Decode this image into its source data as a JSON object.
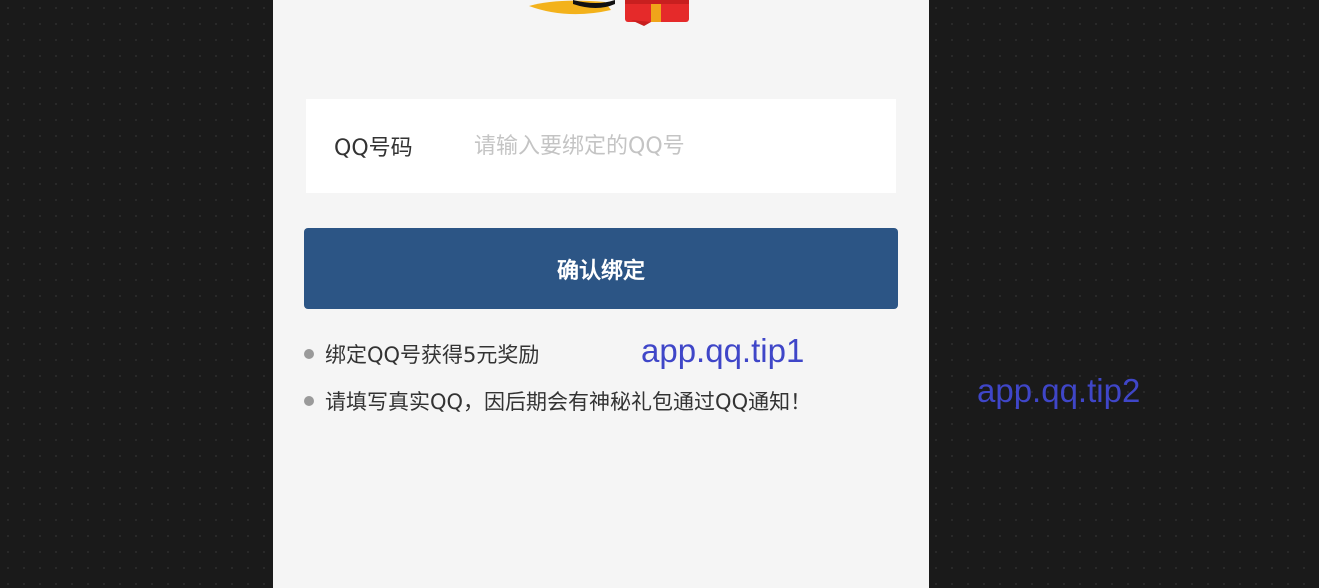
{
  "form": {
    "label": "QQ号码",
    "placeholder": "请输入要绑定的QQ号",
    "value": ""
  },
  "confirm_button": {
    "label": "确认绑定",
    "color": "#2c5585"
  },
  "tips": [
    "绑定QQ号获得5元奖励",
    "请填写真实QQ，因后期会有神秘礼包通过QQ通知！"
  ],
  "i18n_keys": {
    "tip1": "app.qq.tip1",
    "tip2": "app.qq.tip2",
    "color": "#3f46c8"
  },
  "logo": {
    "icon": "qq-penguin-gift-icon"
  }
}
